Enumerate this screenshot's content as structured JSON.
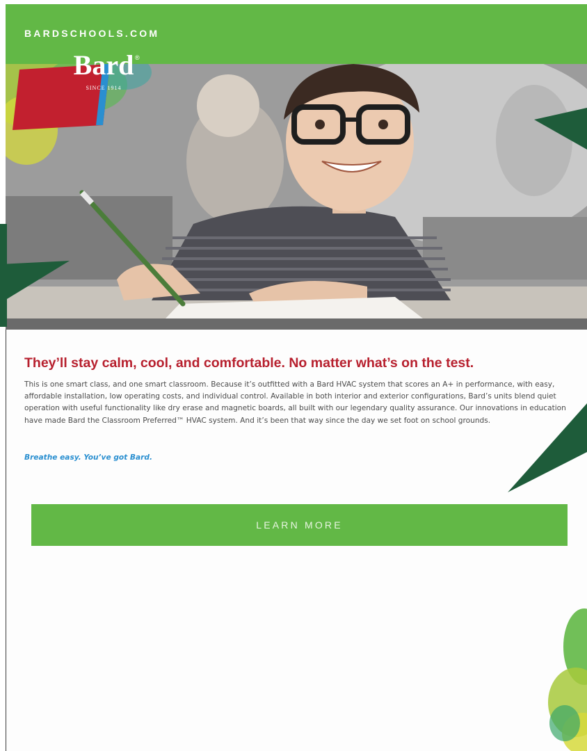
{
  "header": {
    "site_url": "BARDSCHOOLS.COM"
  },
  "brand": {
    "logo_word": "Bard",
    "logo_registered": "®",
    "logo_since": "SINCE 1914",
    "green": "#62b846",
    "red": "#b7202e",
    "blue": "#2a8fd0"
  },
  "hero": {
    "image_subject": "boy-with-glasses-writing-in-classroom"
  },
  "content": {
    "headline": "They’ll stay calm, cool, and comfortable. No matter what’s on the test.",
    "body": "This is one smart class, and one smart classroom. Because it’s outfitted with a Bard HVAC system that scores an A+ in performance, with easy, affordable installation, low operating costs, and individual control. Available in both interior and exterior configurations, Bard’s units blend quiet operation with useful functionality like dry erase and magnetic boards, all built with our legendary quality assurance. Our innovations in education have made Bard the Classroom Preferred™ HVAC system. And it’s been that way since the day we set foot on school grounds.",
    "tagline": "Breathe easy. You’ve got Bard."
  },
  "cta": {
    "label": "LEARN MORE"
  }
}
